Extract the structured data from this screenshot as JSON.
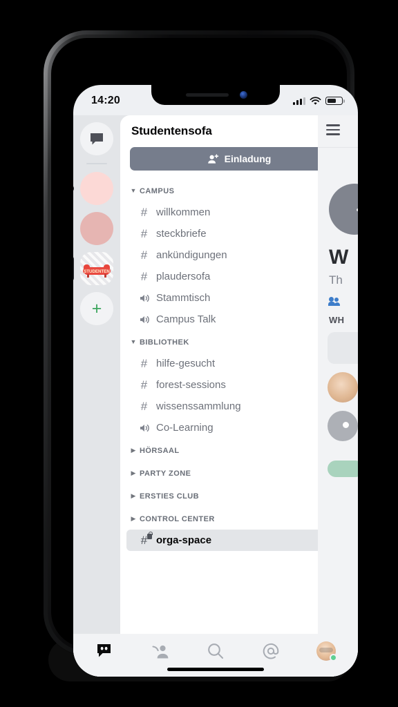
{
  "status_bar": {
    "time": "14:20",
    "signal_icon": "cellular-signal-icon",
    "wifi_icon": "wifi-icon",
    "battery_icon": "battery-icon"
  },
  "server_rail": {
    "items": [
      {
        "name": "direct-messages",
        "icon": "speech-bubble-icon",
        "type": "dm",
        "selected": false
      },
      {
        "name": "server-pink-light",
        "icon": "server-avatar",
        "type": "server",
        "selected": false
      },
      {
        "name": "server-pink-dark",
        "icon": "server-avatar",
        "type": "server",
        "selected": false
      },
      {
        "name": "server-studentensofa",
        "icon": "sofa-logo",
        "logo_text": "STUDENTEN",
        "type": "server",
        "selected": true
      },
      {
        "name": "add-server",
        "icon": "plus-icon",
        "label": "+",
        "type": "add",
        "selected": false
      }
    ]
  },
  "panel": {
    "guild_name": "Studentensofa",
    "more_options_icon": "more-horizontal-icon",
    "invite": {
      "label": "Einladung",
      "icon": "person-add-icon",
      "bg_color": "#767d8c"
    }
  },
  "categories": [
    {
      "name": "CAMPUS",
      "expanded": true,
      "add_label": "+",
      "channels": [
        {
          "name": "willkommen",
          "type": "text",
          "active": false,
          "private": false
        },
        {
          "name": "steckbriefe",
          "type": "text",
          "active": false,
          "private": false
        },
        {
          "name": "ankündigungen",
          "type": "text",
          "active": false,
          "private": false
        },
        {
          "name": "plaudersofa",
          "type": "text",
          "active": false,
          "private": false
        },
        {
          "name": "Stammtisch",
          "type": "voice",
          "active": false,
          "private": false
        },
        {
          "name": "Campus Talk",
          "type": "voice",
          "active": false,
          "private": false
        }
      ]
    },
    {
      "name": "BIBLIOTHEK",
      "expanded": true,
      "add_label": "+",
      "channels": [
        {
          "name": "hilfe-gesucht",
          "type": "text",
          "active": false,
          "private": false
        },
        {
          "name": "forest-sessions",
          "type": "text",
          "active": false,
          "private": false
        },
        {
          "name": "wissenssammlung",
          "type": "text",
          "active": false,
          "private": false
        },
        {
          "name": "Co-Learning",
          "type": "voice",
          "active": false,
          "private": false
        }
      ]
    },
    {
      "name": "HÖRSAAL",
      "expanded": false,
      "add_label": "+",
      "channels": []
    },
    {
      "name": "PARTY ZONE",
      "expanded": false,
      "add_label": "+",
      "channels": []
    },
    {
      "name": "ERSTIES CLUB",
      "expanded": false,
      "add_label": "+",
      "channels": []
    },
    {
      "name": "CONTROL CENTER",
      "expanded": false,
      "add_label": "+",
      "channels": [
        {
          "name": "orga-space",
          "type": "text",
          "active": true,
          "private": true
        }
      ]
    }
  ],
  "right_pane": {
    "menu_icon": "hamburger-menu-icon",
    "title_partial": "W",
    "subtitle_partial": "Th",
    "members_icon": "members-icon",
    "section_partial": "WH"
  },
  "bottom_nav": {
    "items": [
      {
        "name": "servers-tab",
        "icon": "discord-logo-icon",
        "active": true
      },
      {
        "name": "friends-tab",
        "icon": "friends-icon",
        "active": false
      },
      {
        "name": "search-tab",
        "icon": "search-icon",
        "active": false
      },
      {
        "name": "mentions-tab",
        "icon": "at-mention-icon",
        "active": false
      },
      {
        "name": "profile-tab",
        "icon": "user-avatar",
        "active": false,
        "status": "online"
      }
    ]
  }
}
